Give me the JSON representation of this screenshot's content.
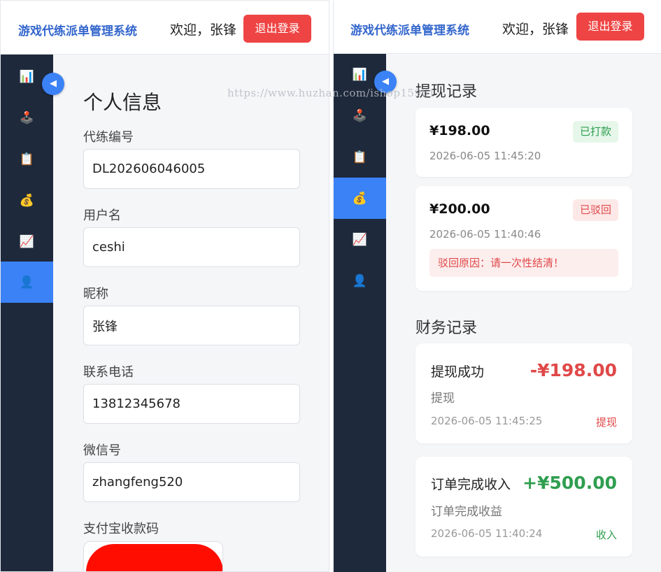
{
  "header": {
    "brand": "游戏代练派单管理系统",
    "welcome": "欢迎，张锋",
    "logout_label": "退出登录"
  },
  "sidebar": {
    "toggle_glyph": "◀",
    "items": [
      {
        "icon": "chart-icon",
        "glyph": "📊"
      },
      {
        "icon": "joystick-icon",
        "glyph": "🕹️"
      },
      {
        "icon": "clipboard-icon",
        "glyph": "📋"
      },
      {
        "icon": "money-bag-icon",
        "glyph": "💰"
      },
      {
        "icon": "trend-chart-icon",
        "glyph": "📈"
      },
      {
        "icon": "user-icon",
        "glyph": "👤"
      }
    ]
  },
  "watermark": "https://www.huzhan.com/ishop15961",
  "profile": {
    "title": "个人信息",
    "fields": [
      {
        "label": "代练编号",
        "value": "DL202606046005"
      },
      {
        "label": "用户名",
        "value": "ceshi"
      },
      {
        "label": "昵称",
        "value": "张锋"
      },
      {
        "label": "联系电话",
        "value": "13812345678"
      },
      {
        "label": "微信号",
        "value": "zhangfeng520"
      }
    ],
    "qr_label": "支付宝收款码"
  },
  "withdrawals": {
    "title": "提现记录",
    "records": [
      {
        "amount": "¥198.00",
        "time": "2026-06-05 11:45:20",
        "status": "已打款"
      },
      {
        "amount": "¥200.00",
        "time": "2026-06-05 11:40:46",
        "status": "已驳回",
        "reject_reason": "驳回原因：请一次性结清！"
      }
    ]
  },
  "finance": {
    "title": "财务记录",
    "records": [
      {
        "title": "提现成功",
        "amount": "-¥198.00",
        "desc": "提现",
        "time": "2026-06-05 11:45:25",
        "type": "提现"
      },
      {
        "title": "订单完成收入",
        "amount": "+¥500.00",
        "desc": "订单完成收益",
        "time": "2026-06-05 11:40:24",
        "type": "收入"
      }
    ]
  },
  "colors": {
    "accent": "#3b82f6",
    "sidebar_bg": "#1e293b",
    "logout_bg": "#ef4444",
    "negative": "#e04848",
    "positive": "#2f9e4f"
  }
}
